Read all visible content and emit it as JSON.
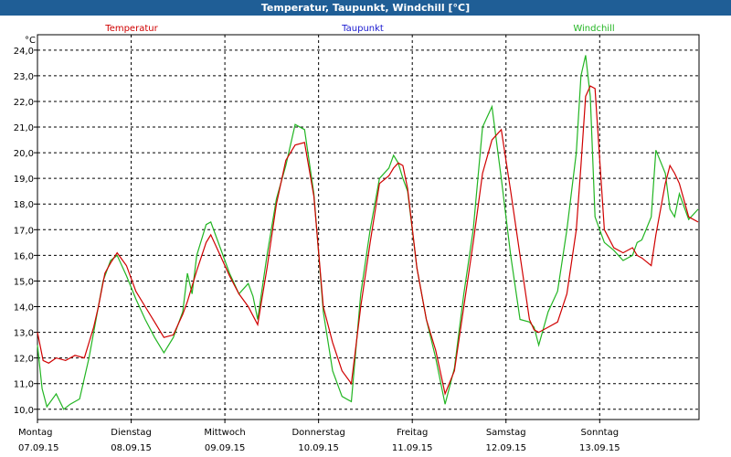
{
  "window": {
    "title": "Temperatur, Taupunkt, Windchill [°C]"
  },
  "colors": {
    "titlebar": "#1f5e96",
    "temperatur": "#d00000",
    "taupunkt": "#1a1ad0",
    "windchill": "#22b522",
    "grid": "#000000"
  },
  "chart_data": {
    "type": "line",
    "title": "Temperatur, Taupunkt, Windchill [°C]",
    "ylabel": "°C",
    "ylim": [
      9.6,
      24.6
    ],
    "xlim": [
      0,
      7.06
    ],
    "yticks": [
      "10,0",
      "11,0",
      "12,0",
      "13,0",
      "14,0",
      "15,0",
      "16,0",
      "17,0",
      "18,0",
      "19,0",
      "20,0",
      "21,0",
      "22,0",
      "23,0",
      "24,0"
    ],
    "xticks": [
      {
        "day": "Montag",
        "date": "07.09.15"
      },
      {
        "day": "Dienstag",
        "date": "08.09.15"
      },
      {
        "day": "Mittwoch",
        "date": "09.09.15"
      },
      {
        "day": "Donnerstag",
        "date": "10.09.15"
      },
      {
        "day": "Freitag",
        "date": "11.09.15"
      },
      {
        "day": "Samstag",
        "date": "12.09.15"
      },
      {
        "day": "Sonntag",
        "date": "13.09.15"
      }
    ],
    "grid": true,
    "legend_position": "top",
    "series": [
      {
        "name": "Temperatur",
        "color": "#d00000",
        "x": [
          0,
          0.06,
          0.12,
          0.2,
          0.3,
          0.4,
          0.5,
          0.6,
          0.65,
          0.72,
          0.78,
          0.85,
          0.95,
          1.05,
          1.15,
          1.25,
          1.35,
          1.45,
          1.55,
          1.6,
          1.7,
          1.8,
          1.85,
          1.95,
          2.05,
          2.15,
          2.25,
          2.35,
          2.45,
          2.55,
          2.65,
          2.75,
          2.85,
          2.95,
          3.05,
          3.15,
          3.25,
          3.35,
          3.45,
          3.55,
          3.65,
          3.75,
          3.8,
          3.85,
          3.9,
          3.95,
          4.05,
          4.15,
          4.25,
          4.35,
          4.45,
          4.55,
          4.65,
          4.75,
          4.85,
          4.95,
          5.05,
          5.15,
          5.25,
          5.3,
          5.35,
          5.45,
          5.55,
          5.65,
          5.75,
          5.8,
          5.85,
          5.9,
          5.95,
          6.05,
          6.15,
          6.25,
          6.35,
          6.4,
          6.45,
          6.55,
          6.6,
          6.7,
          6.75,
          6.8,
          6.85,
          6.95,
          7.05
        ],
        "values": [
          13.0,
          11.9,
          11.8,
          12.0,
          11.9,
          12.1,
          12.0,
          13.2,
          14.0,
          15.3,
          15.7,
          16.1,
          15.6,
          14.6,
          14.0,
          13.4,
          12.8,
          12.9,
          13.7,
          14.2,
          15.4,
          16.5,
          16.8,
          16.0,
          15.2,
          14.5,
          14.0,
          13.3,
          15.5,
          18.0,
          19.7,
          20.3,
          20.4,
          18.3,
          14.0,
          12.6,
          11.5,
          11.0,
          14.0,
          16.5,
          18.8,
          19.1,
          19.4,
          19.6,
          19.5,
          18.6,
          15.5,
          13.5,
          12.3,
          10.6,
          11.5,
          14.0,
          16.5,
          19.2,
          20.5,
          20.9,
          18.5,
          16.0,
          13.5,
          13.1,
          13.0,
          13.2,
          13.4,
          14.5,
          17.0,
          19.5,
          22.2,
          22.6,
          22.5,
          17.0,
          16.3,
          16.1,
          16.3,
          16.0,
          15.9,
          15.6,
          16.8,
          18.8,
          19.5,
          19.2,
          18.8,
          17.5,
          17.3
        ]
      },
      {
        "name": "Taupunkt",
        "color": "#1a1ad0",
        "x": [],
        "values": []
      },
      {
        "name": "Windchill",
        "color": "#22b522",
        "x": [
          0,
          0.05,
          0.1,
          0.2,
          0.28,
          0.35,
          0.45,
          0.55,
          0.6,
          0.7,
          0.78,
          0.85,
          0.95,
          1.05,
          1.15,
          1.25,
          1.35,
          1.45,
          1.55,
          1.6,
          1.65,
          1.7,
          1.8,
          1.85,
          1.95,
          2.05,
          2.15,
          2.25,
          2.3,
          2.35,
          2.45,
          2.55,
          2.65,
          2.75,
          2.85,
          2.95,
          3.05,
          3.15,
          3.25,
          3.35,
          3.45,
          3.55,
          3.65,
          3.75,
          3.8,
          3.85,
          3.9,
          3.95,
          4.05,
          4.15,
          4.25,
          4.35,
          4.45,
          4.55,
          4.65,
          4.75,
          4.85,
          4.95,
          5.05,
          5.15,
          5.25,
          5.3,
          5.35,
          5.45,
          5.55,
          5.65,
          5.75,
          5.8,
          5.85,
          5.9,
          5.95,
          6.05,
          6.15,
          6.25,
          6.35,
          6.4,
          6.45,
          6.55,
          6.6,
          6.7,
          6.75,
          6.8,
          6.85,
          6.95,
          7.05
        ],
        "values": [
          12.5,
          10.8,
          10.1,
          10.6,
          10.0,
          10.2,
          10.4,
          12.0,
          13.0,
          15.0,
          15.8,
          16.0,
          15.2,
          14.3,
          13.5,
          12.8,
          12.2,
          12.8,
          13.8,
          15.3,
          14.5,
          16.0,
          17.2,
          17.3,
          16.3,
          15.3,
          14.5,
          14.9,
          14.4,
          13.5,
          16.0,
          18.2,
          19.5,
          21.1,
          20.9,
          18.4,
          13.8,
          11.5,
          10.5,
          10.3,
          14.5,
          17.0,
          19.0,
          19.4,
          19.9,
          19.6,
          19.0,
          18.5,
          15.5,
          13.5,
          12.0,
          10.2,
          11.6,
          14.5,
          17.0,
          21.0,
          21.8,
          19.0,
          16.0,
          13.5,
          13.4,
          13.2,
          12.5,
          13.8,
          14.6,
          17.0,
          20.0,
          23.0,
          23.8,
          22.2,
          17.5,
          16.5,
          16.2,
          15.8,
          16.0,
          16.5,
          16.6,
          17.5,
          20.1,
          19.2,
          17.8,
          17.5,
          18.4,
          17.4,
          17.8
        ]
      }
    ]
  }
}
